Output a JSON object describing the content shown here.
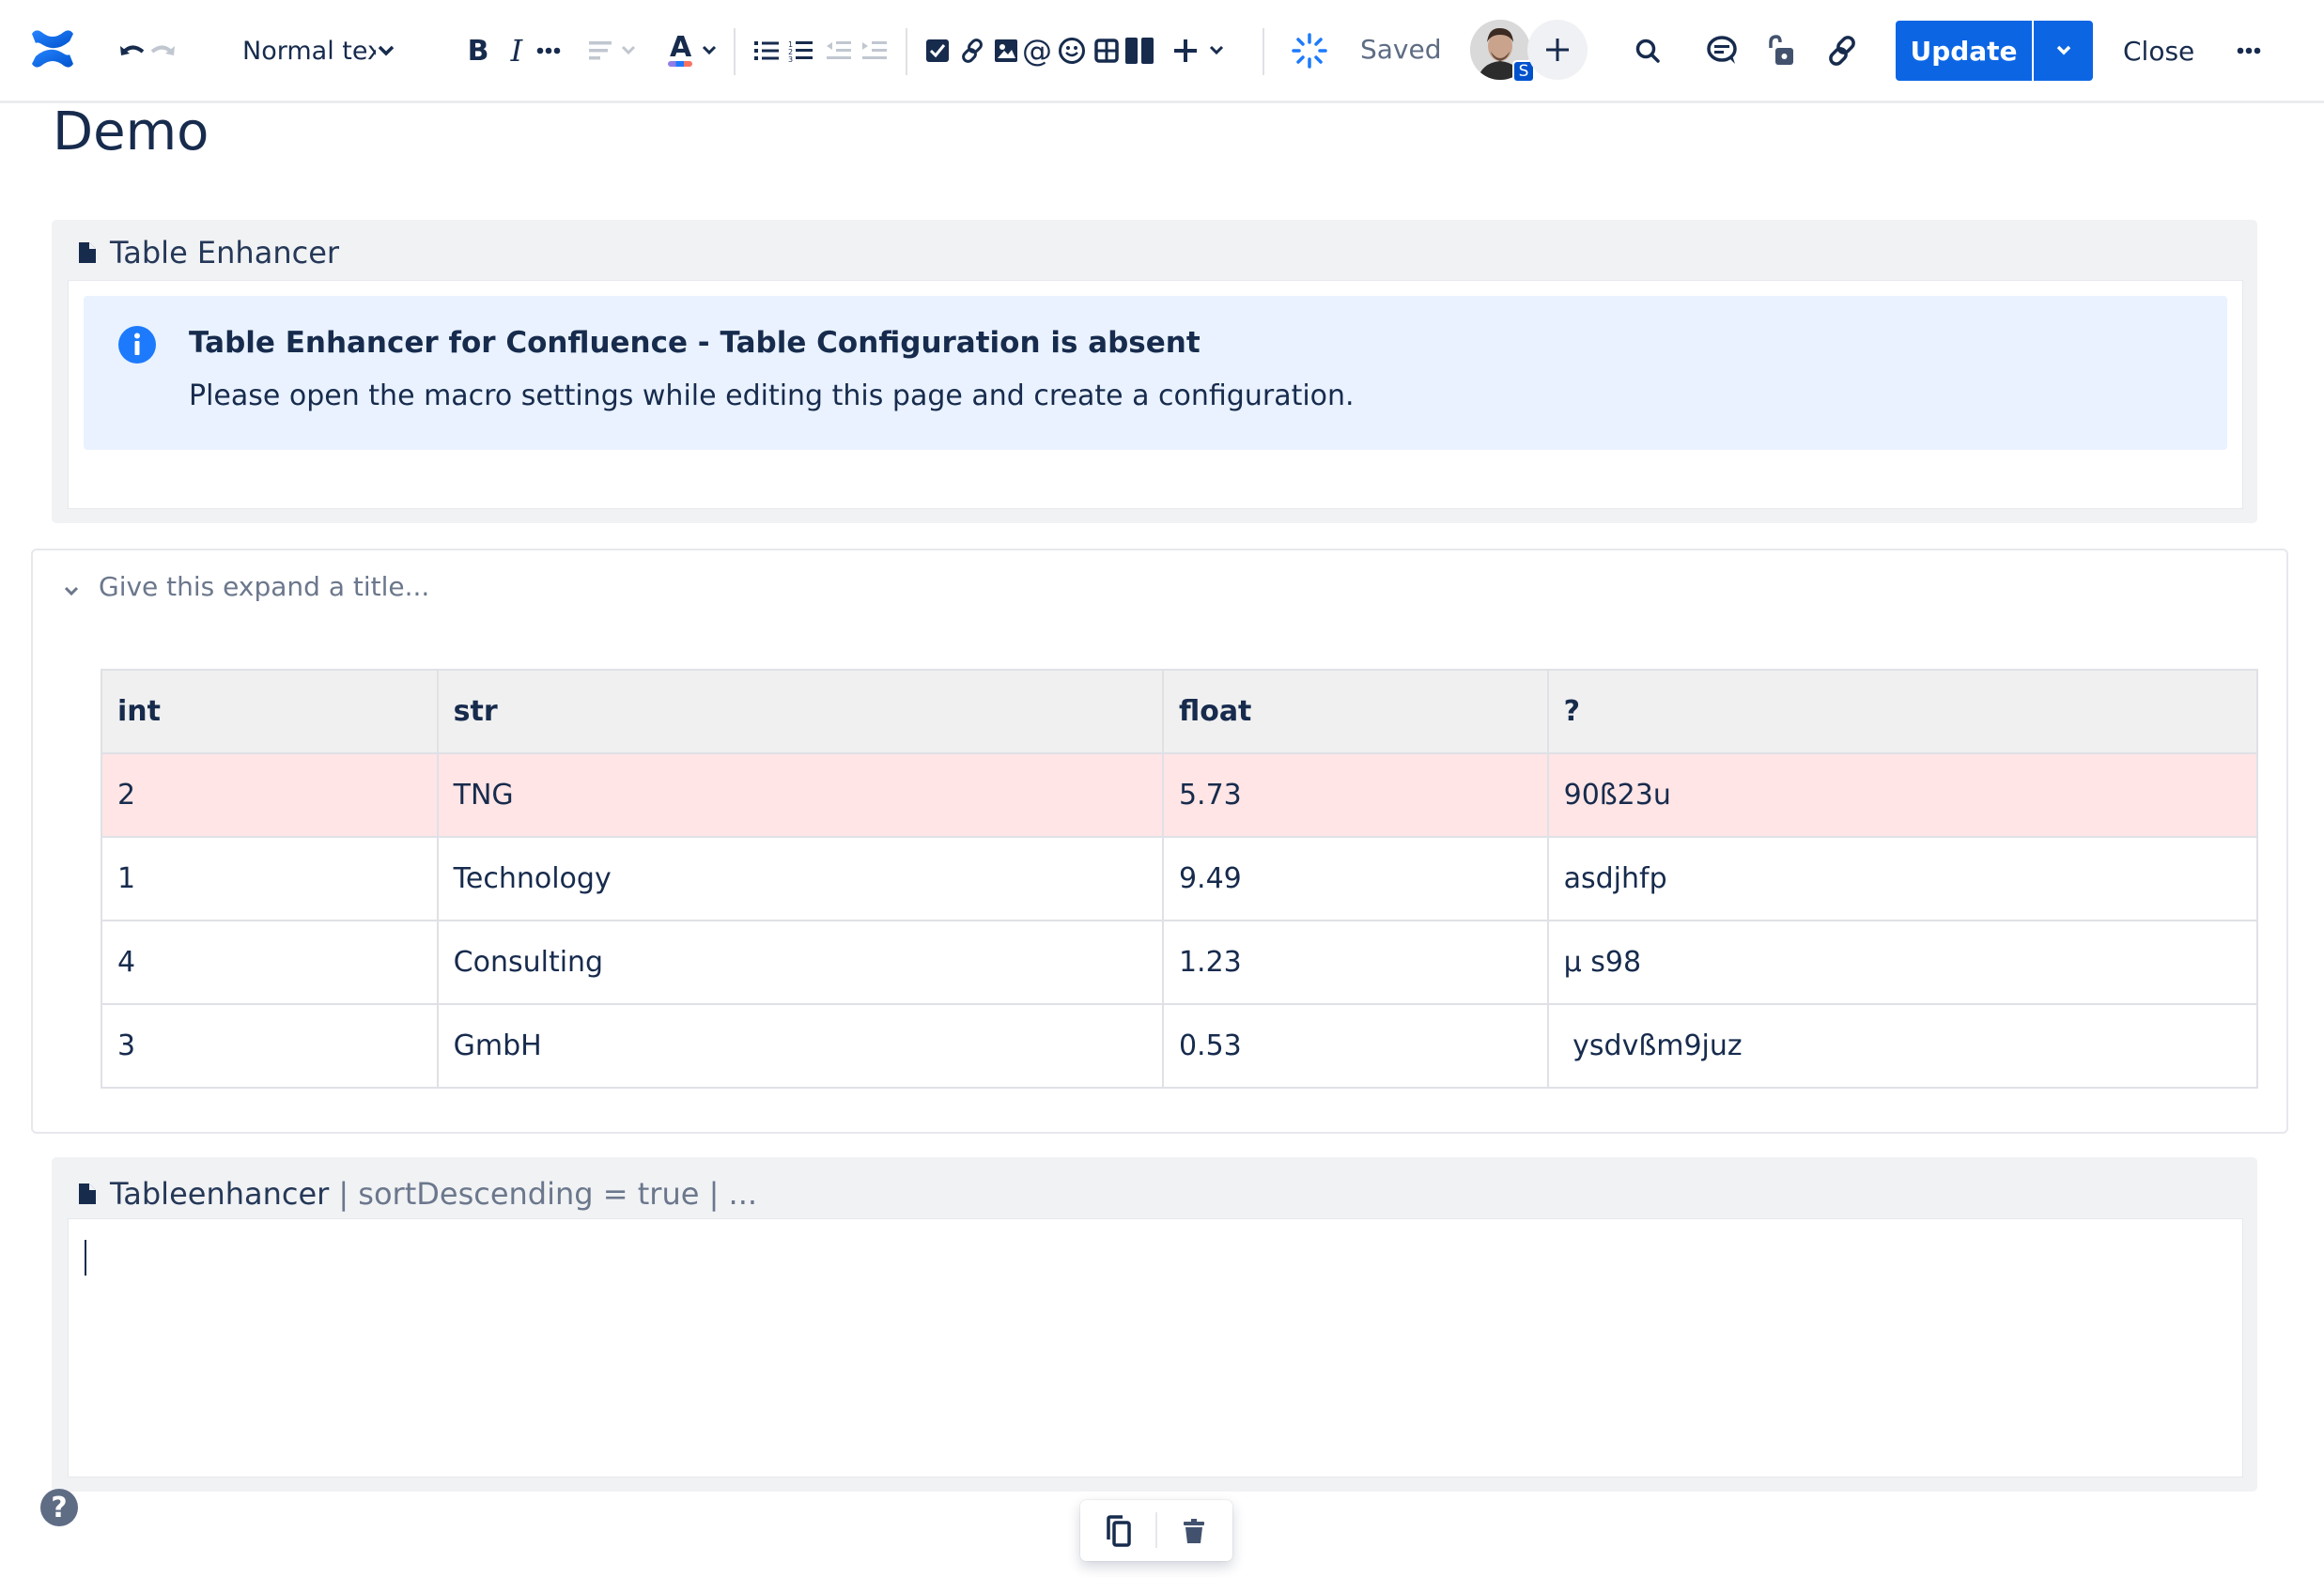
{
  "toolbar": {
    "logo": "confluence-logo",
    "text_style": "Normal text",
    "status": "Saved",
    "avatar_badge": "S",
    "update_label": "Update",
    "close_label": "Close",
    "icons": {
      "undo": "undo-icon",
      "redo": "redo-icon",
      "bold": "B",
      "italic": "I",
      "more_formatting": "…",
      "align": "align-left-icon",
      "text_color": "A",
      "bullet_list": "bullet-list-icon",
      "numbered_list": "numbered-list-icon",
      "outdent": "outdent-icon",
      "indent": "indent-icon",
      "task": "checkbox-icon",
      "link": "link-icon",
      "image": "image-icon",
      "mention": "@",
      "emoji": "emoji-icon",
      "table": "table-icon",
      "layout": "layout-icon",
      "insert": "+",
      "sync": "sync-icon",
      "find": "search-icon",
      "comment": "comment-icon",
      "restrictions": "unlock-icon",
      "copy_link": "link-icon",
      "more": "more-icon"
    }
  },
  "page": {
    "title": "Demo"
  },
  "macro1": {
    "name": "Table Enhancer",
    "info_title": "Table Enhancer for Confluence - Table Configuration is absent",
    "info_text": "Please open the macro settings while editing this page and create a configuration."
  },
  "expand": {
    "title_placeholder": "Give this expand a title...",
    "title_value": ""
  },
  "table": {
    "headers": [
      "int",
      "str",
      "float",
      "?"
    ],
    "rows": [
      {
        "cells": [
          "2",
          "TNG",
          "5.73",
          "90ß23u"
        ],
        "highlight": true
      },
      {
        "cells": [
          "1",
          "Technology",
          "9.49",
          "asdjhfp"
        ],
        "highlight": false
      },
      {
        "cells": [
          "4",
          "Consulting",
          "1.23",
          "µ s98"
        ],
        "highlight": false
      },
      {
        "cells": [
          "3",
          "GmbH",
          "0.53",
          " ysdvßm9juz"
        ],
        "highlight": false
      }
    ],
    "highlight_color": "#ffe5e5",
    "header_color": "#f0f0f0"
  },
  "macro2": {
    "name": "Tableenhancer",
    "params": "| sortDescending = true | ..."
  },
  "floating_toolbar": {
    "copy": "copy-icon",
    "delete": "delete-icon"
  },
  "help": {
    "label": "?"
  },
  "colors": {
    "primary": "#0c66e4",
    "text": "#172b4d",
    "subtle_text": "#6b778c",
    "info_bg": "#e9f2fe",
    "info_icon": "#1d7afc",
    "macro_bg": "#f1f2f4"
  }
}
